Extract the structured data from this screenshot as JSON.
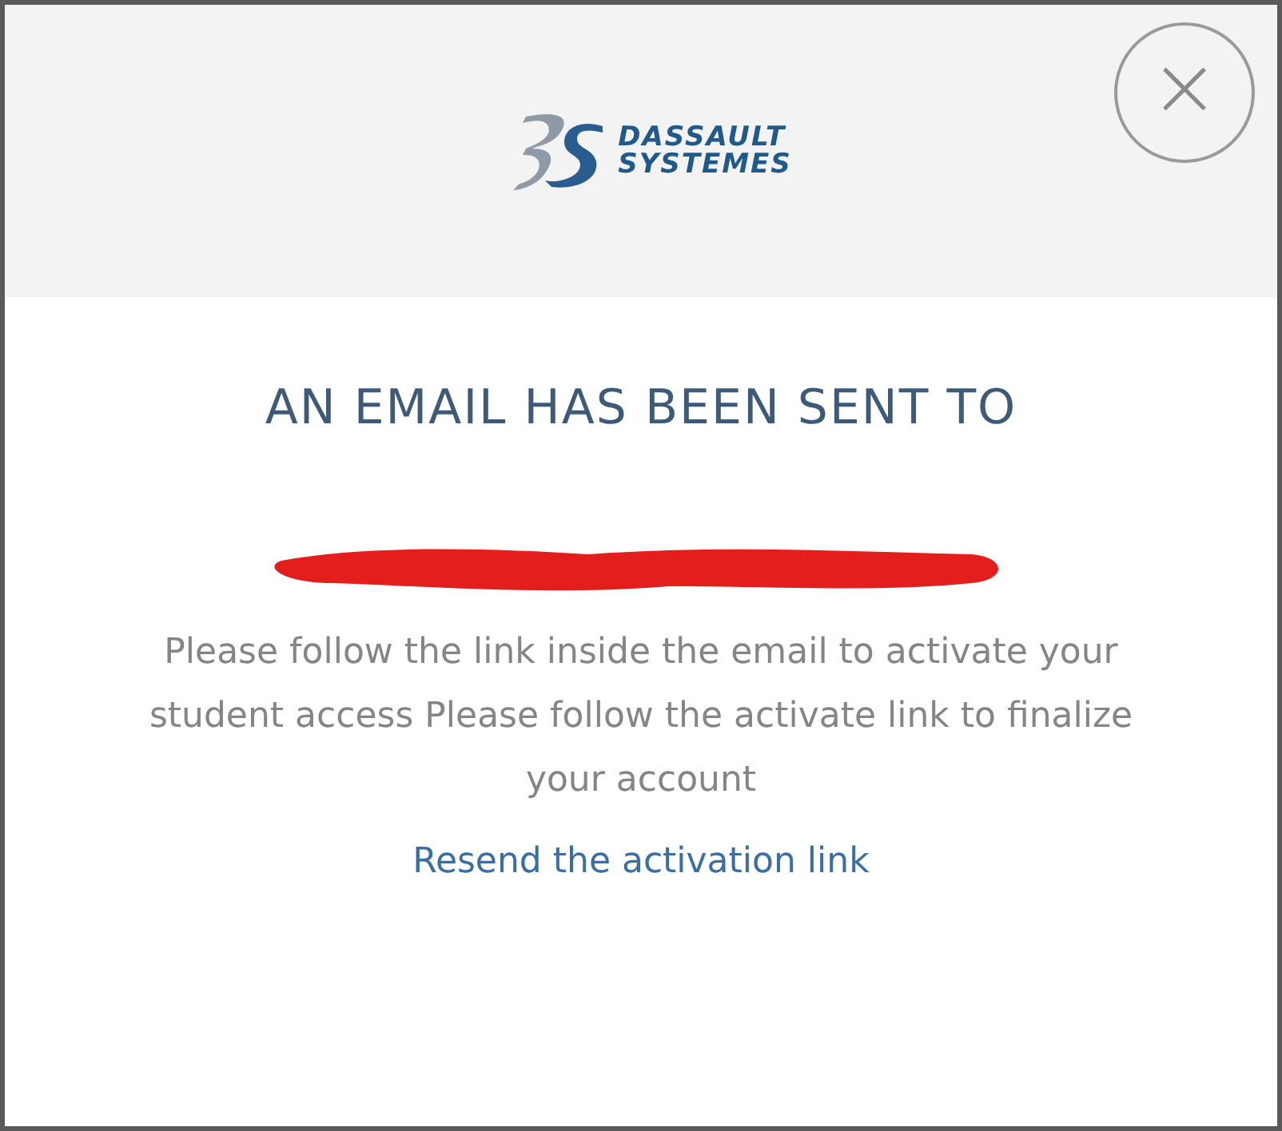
{
  "logo": {
    "line_1": "DASSAULT",
    "line_2": "SYSTEMES"
  },
  "close": {
    "symbol": "×"
  },
  "title": "AN EMAIL HAS BEEN SENT TO",
  "email": {
    "kind": "redacted"
  },
  "message": "Please follow the link inside the email to activate your student access Please follow the activate link to finalize your account",
  "link": "Resend the activation link"
}
